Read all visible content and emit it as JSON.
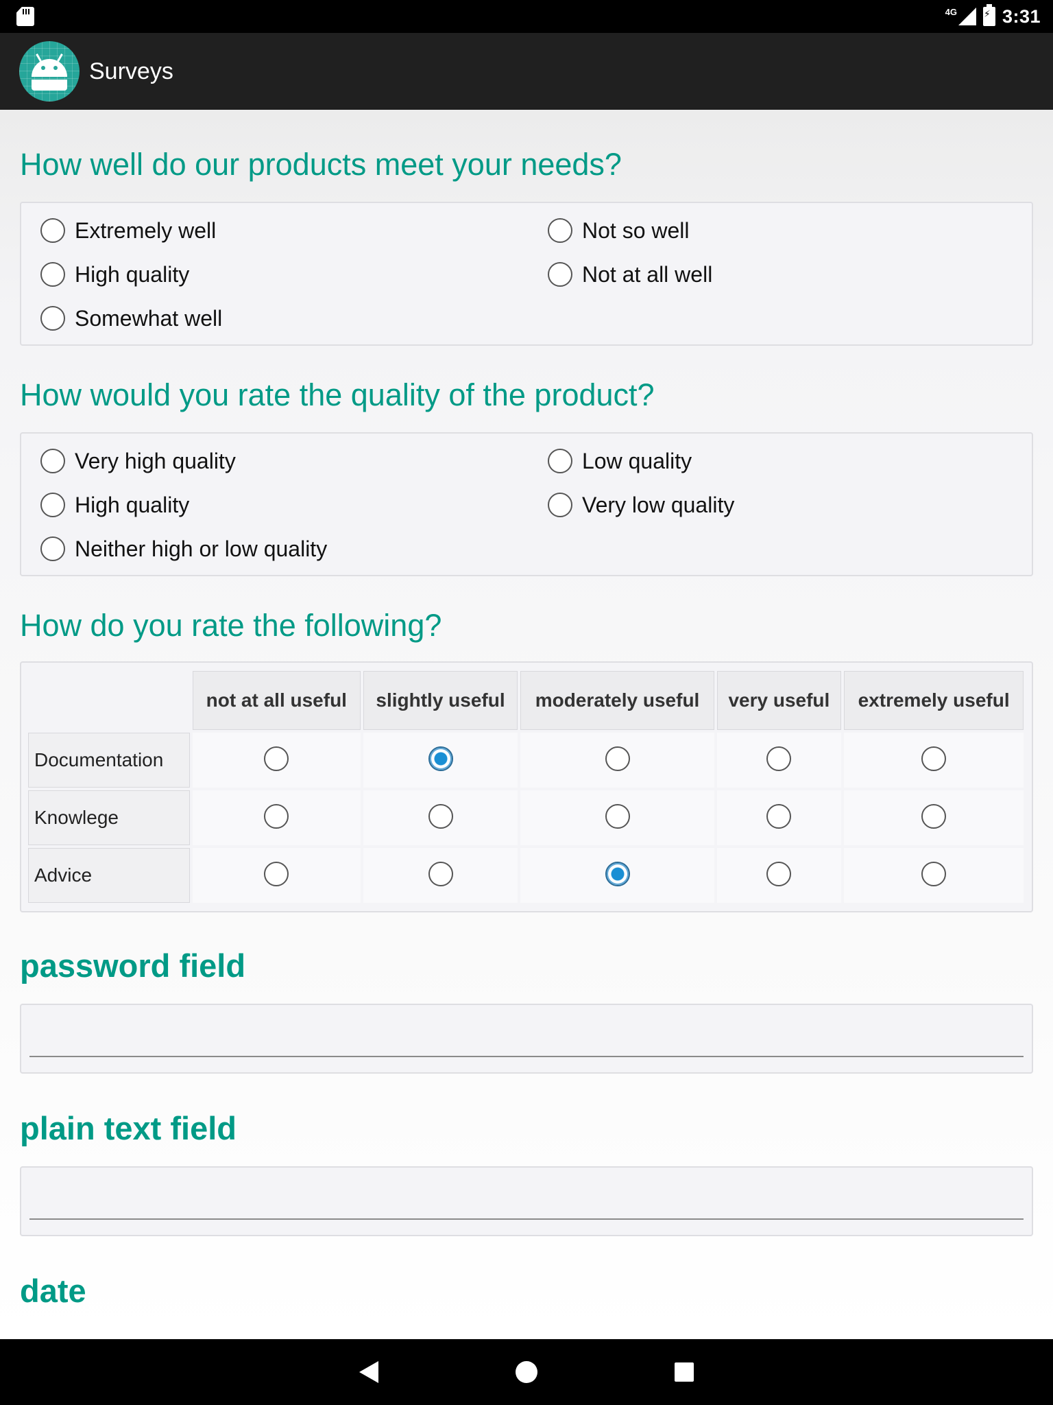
{
  "status_bar": {
    "network": "4G",
    "time": "3:31"
  },
  "app_bar": {
    "title": "Surveys"
  },
  "questions": {
    "q1": {
      "title": "How well do our products meet your needs?",
      "options": [
        "Extremely well",
        "Not so well",
        "High quality",
        "Not at all well",
        "Somewhat well"
      ]
    },
    "q2": {
      "title": "How would you rate the quality of the product?",
      "options": [
        "Very high quality",
        "Low quality",
        "High quality",
        "Very low quality",
        "Neither high or low quality"
      ]
    },
    "q3": {
      "title": "How do you rate the following?",
      "columns": [
        "not at all useful",
        "slightly useful",
        "moderately useful",
        "very useful",
        "extremely useful"
      ],
      "rows": [
        {
          "label": "Documentation",
          "selected": "slightly useful"
        },
        {
          "label": "Knowlege",
          "selected": ""
        },
        {
          "label": "Advice",
          "selected": "moderately useful"
        }
      ]
    }
  },
  "fields": {
    "password": {
      "label": "password field",
      "value": ""
    },
    "plain_text": {
      "label": "plain text field",
      "value": ""
    },
    "date": {
      "label": "date"
    }
  },
  "colors": {
    "accent": "#009a86",
    "radio_selected": "#1a8fd4",
    "app_bar": "#202020"
  }
}
